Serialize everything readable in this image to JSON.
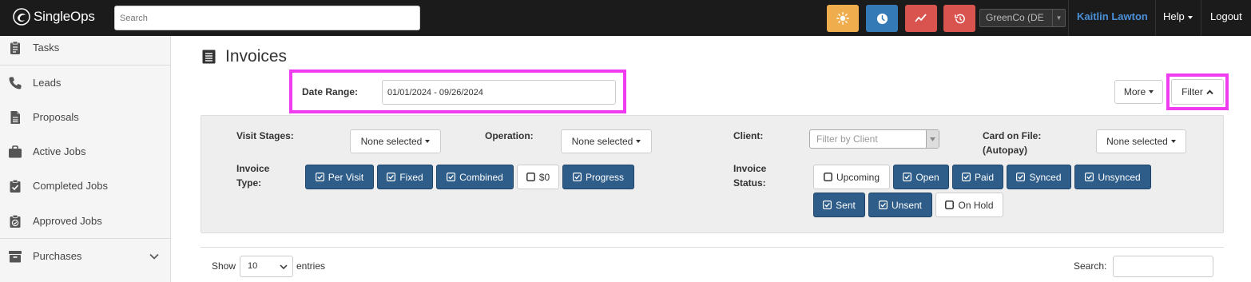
{
  "app": {
    "brand": "SingleOps"
  },
  "topbar": {
    "search_placeholder": "Search",
    "buttons": [
      {
        "name": "sun-button",
        "color": "#f0ad4e",
        "icon": "sun-icon"
      },
      {
        "name": "clock-button",
        "color": "#337ab7",
        "icon": "clock-icon"
      },
      {
        "name": "trend-button",
        "color": "#d9534f",
        "icon": "trend-icon"
      },
      {
        "name": "history-button",
        "color": "#d9534f",
        "icon": "history-icon"
      }
    ],
    "company": "GreenCo (DE",
    "user": "Kaitlin Lawton",
    "help": "Help",
    "logout": "Logout"
  },
  "sidebar": {
    "items": [
      {
        "label": "Tasks",
        "icon": "clipboard-icon"
      },
      {
        "label": "Leads",
        "icon": "phone-icon"
      },
      {
        "label": "Proposals",
        "icon": "document-icon"
      },
      {
        "label": "Active Jobs",
        "icon": "briefcase-icon"
      },
      {
        "label": "Completed Jobs",
        "icon": "clipboard-check-icon"
      },
      {
        "label": "Approved Jobs",
        "icon": "badge-check-icon"
      },
      {
        "label": "Purchases",
        "icon": "archive-icon"
      }
    ]
  },
  "main": {
    "title": "Invoices",
    "date_range_label": "Date Range:",
    "date_range_value": "01/01/2024 - 09/26/2024",
    "more_label": "More",
    "filter_label": "Filter"
  },
  "filters": {
    "visit_stages_label": "Visit Stages:",
    "visit_stages_value": "None selected",
    "operation_label": "Operation:",
    "operation_value": "None selected",
    "client_label": "Client:",
    "client_placeholder": "Filter by Client",
    "card_label_1": "Card on File:",
    "card_label_2": "(Autopay)",
    "card_value": "None selected",
    "invoice_type_label_1": "Invoice",
    "invoice_type_label_2": "Type:",
    "invoice_types": [
      {
        "label": "Per Visit",
        "checked": true
      },
      {
        "label": "Fixed",
        "checked": true
      },
      {
        "label": "Combined",
        "checked": true
      },
      {
        "label": "$0",
        "checked": false
      },
      {
        "label": "Progress",
        "checked": true
      }
    ],
    "invoice_status_label_1": "Invoice",
    "invoice_status_label_2": "Status:",
    "invoice_statuses": [
      {
        "label": "Upcoming",
        "checked": false
      },
      {
        "label": "Open",
        "checked": true
      },
      {
        "label": "Paid",
        "checked": true
      },
      {
        "label": "Synced",
        "checked": true
      },
      {
        "label": "Unsynced",
        "checked": true
      },
      {
        "label": "Sent",
        "checked": true
      },
      {
        "label": "Unsent",
        "checked": true
      },
      {
        "label": "On Hold",
        "checked": false
      }
    ]
  },
  "table": {
    "show_label": "Show",
    "entries_value": "10",
    "entries_label": "entries",
    "search_label": "Search:"
  }
}
